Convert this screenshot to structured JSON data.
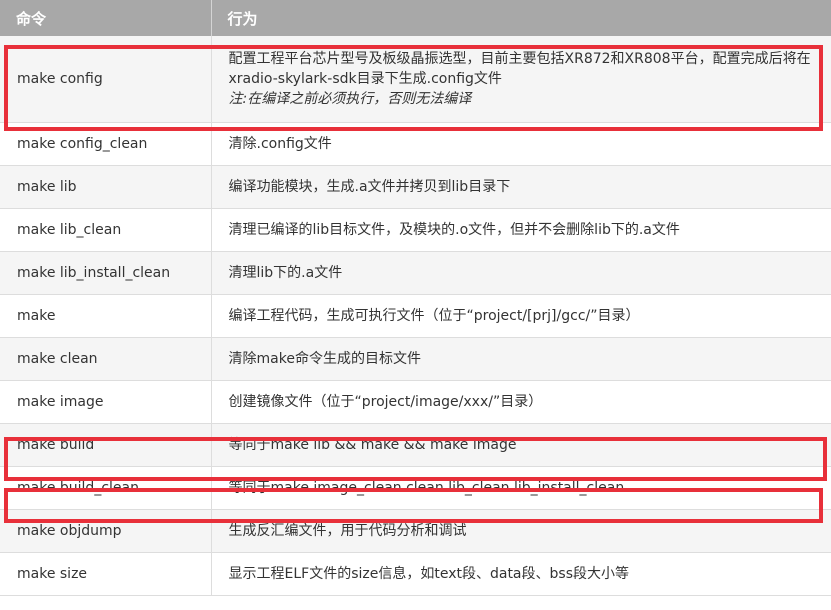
{
  "table": {
    "headers": {
      "command": "命令",
      "action": "行为"
    },
    "rows": [
      {
        "command": "make config",
        "action_line1": "配置工程平台芯片型号及板级晶振选型，目前主要包括XR872和XR808平台，配置完成后将在xradio-skylark-sdk目录下生成.config文件",
        "note": "注:在编译之前必须执行，否则无法编译",
        "highlighted": true
      },
      {
        "command": "make config_clean",
        "action": "清除.config文件",
        "highlighted": false
      },
      {
        "command": "make lib",
        "action": "编译功能模块，生成.a文件并拷贝到lib目录下",
        "highlighted": false
      },
      {
        "command": "make lib_clean",
        "action": "清理已编译的lib目标文件，及模块的.o文件，但并不会删除lib下的.a文件",
        "highlighted": false
      },
      {
        "command": "make lib_install_clean",
        "action": "清理lib下的.a文件",
        "highlighted": false
      },
      {
        "command": "make",
        "action": "编译工程代码，生成可执行文件（位于“project/[prj]/gcc/”目录）",
        "highlighted": false
      },
      {
        "command": "make clean",
        "action": "清除make命令生成的目标文件",
        "highlighted": false
      },
      {
        "command": "make image",
        "action": "创建镜像文件（位于“project/image/xxx/”目录）",
        "highlighted": false
      },
      {
        "command": "make build",
        "action": "等同于make lib && make && make image",
        "highlighted": true
      },
      {
        "command": "make build_clean",
        "action": "等同于make image_clean clean lib_clean lib_install_clean",
        "highlighted": true
      },
      {
        "command": "make objdump",
        "action": "生成反汇编文件，用于代码分析和调试",
        "highlighted": false
      },
      {
        "command": "make size",
        "action": "显示工程ELF文件的size信息，如text段、data段、bss段大小等",
        "highlighted": false
      }
    ]
  },
  "highlight_color": "#e8303a"
}
